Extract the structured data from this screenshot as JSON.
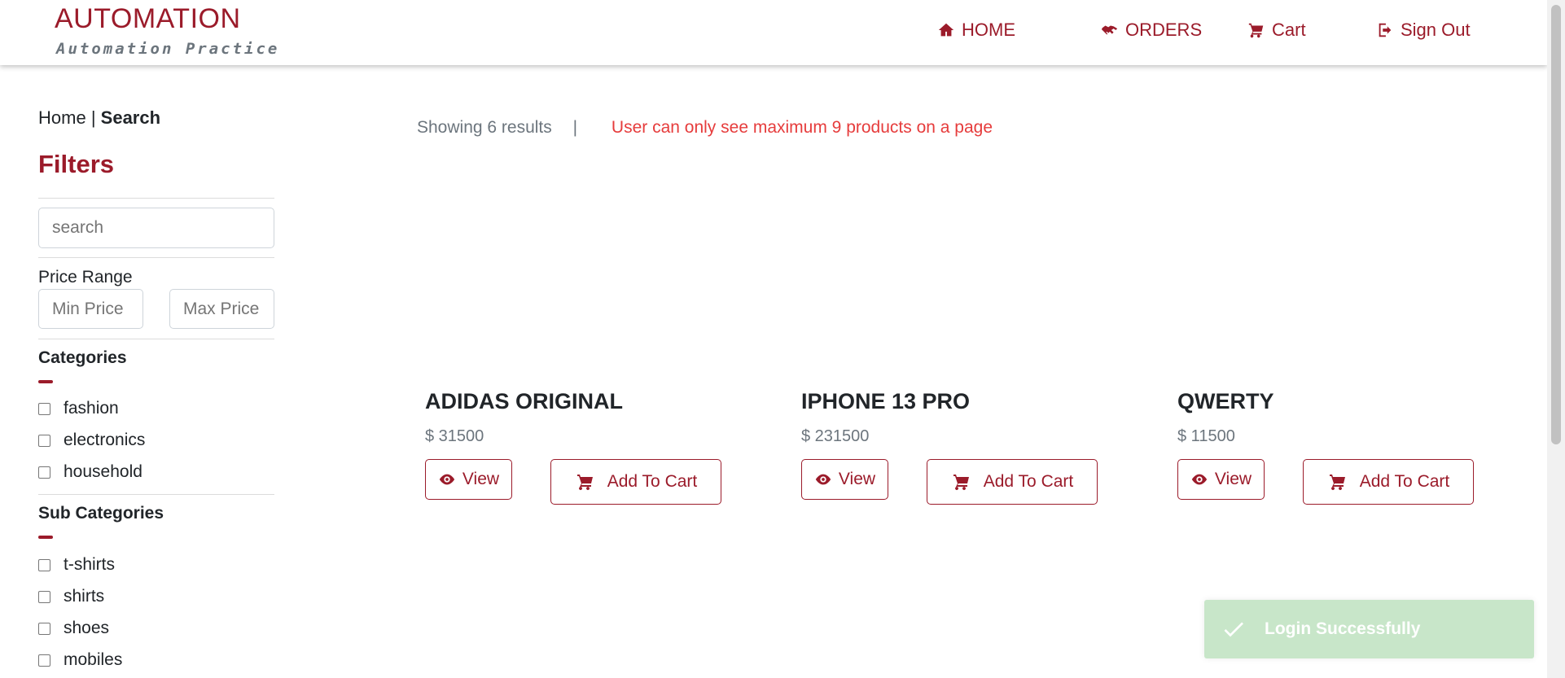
{
  "header": {
    "brand_title": "AUTOMATION",
    "brand_subtitle": "Automation Practice",
    "nav": [
      {
        "label": "HOME",
        "icon": "home-icon"
      },
      {
        "label": "ORDERS",
        "icon": "handshake-icon"
      },
      {
        "label": "Cart",
        "icon": "cart-icon"
      },
      {
        "label": "Sign Out",
        "icon": "sign-out-icon"
      }
    ]
  },
  "sidebar": {
    "breadcrumb_home": "Home",
    "breadcrumb_sep": "|",
    "breadcrumb_current": "Search",
    "filters_title": "Filters",
    "search_placeholder": "search",
    "price_range_label": "Price Range",
    "min_price_placeholder": "Min Price",
    "max_price_placeholder": "Max Price",
    "categories_label": "Categories",
    "categories": [
      "fashion",
      "electronics",
      "household"
    ],
    "subcategories_label": "Sub Categories",
    "subcategories": [
      "t-shirts",
      "shirts",
      "shoes",
      "mobiles"
    ]
  },
  "main": {
    "results_text": "Showing 6 results",
    "results_sep": "|",
    "limit_notice": "User can only see maximum 9 products on a page",
    "products": [
      {
        "name": "ADIDAS ORIGINAL",
        "price": "$ 31500"
      },
      {
        "name": "IPHONE 13 PRO",
        "price": "$ 231500"
      },
      {
        "name": "QWERTY",
        "price": "$ 11500"
      }
    ],
    "view_label": "View",
    "add_to_cart_label": "Add To Cart"
  },
  "toast": {
    "message": "Login Successfully",
    "icon": "check-icon"
  },
  "colors": {
    "brand": "#9b1b2a",
    "warning": "#e63c3c",
    "toast_bg": "#c8e6c9"
  }
}
